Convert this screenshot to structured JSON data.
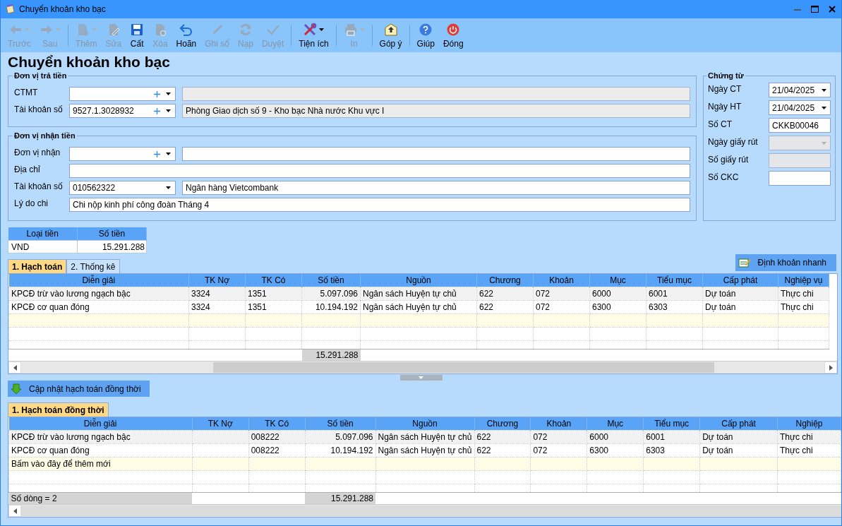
{
  "window": {
    "title": "Chuyển khoản kho bạc"
  },
  "toolbar": {
    "groups": [
      [
        {
          "kind": "back",
          "label": "Trước",
          "disabled": true,
          "dropdown": true
        },
        {
          "kind": "forward",
          "label": "Sau",
          "disabled": true,
          "dropdown": true
        }
      ],
      [
        {
          "kind": "new",
          "label": "Thêm",
          "disabled": true,
          "dropdown": true
        },
        {
          "kind": "edit",
          "label": "Sửa",
          "disabled": true,
          "dropdown": false
        },
        {
          "kind": "save",
          "label": "Cất",
          "disabled": false,
          "dropdown": false
        },
        {
          "kind": "delete",
          "label": "Xóa",
          "disabled": true,
          "dropdown": false
        },
        {
          "kind": "undo",
          "label": "Hoãn",
          "disabled": false,
          "dropdown": false
        },
        {
          "kind": "post",
          "label": "Ghi sổ",
          "disabled": true,
          "dropdown": false
        },
        {
          "kind": "reload",
          "label": "Nạp",
          "disabled": true,
          "dropdown": false
        },
        {
          "kind": "approve",
          "label": "Duyệt",
          "disabled": true,
          "dropdown": false
        }
      ],
      [
        {
          "kind": "tools",
          "label": "Tiện ích",
          "disabled": false,
          "dropdown": true
        }
      ],
      [
        {
          "kind": "print",
          "label": "In",
          "disabled": true,
          "dropdown": true
        }
      ],
      [
        {
          "kind": "feedback",
          "label": "Góp ý",
          "disabled": false,
          "dropdown": false
        }
      ],
      [
        {
          "kind": "help",
          "label": "Giúp",
          "disabled": false,
          "dropdown": false
        },
        {
          "kind": "close",
          "label": "Đóng",
          "disabled": false,
          "dropdown": false
        }
      ]
    ]
  },
  "heading": "Chuyển khoản kho bạc",
  "payer": {
    "legend": "Đơn vị trả tiền",
    "rows": [
      {
        "kind": "combo",
        "label": "CTMT",
        "add": true,
        "description_readonly": true
      },
      {
        "kind": "combo",
        "label": "Tài khoản số",
        "value": "9527.1.3028932",
        "add": true,
        "description": "Phòng Giao dịch số 9 - Kho bạc Nhà nước Khu vực I",
        "description_readonly": true
      }
    ]
  },
  "payee": {
    "legend": "Đơn vị nhận tiền",
    "rows": [
      {
        "kind": "combo",
        "label": "Đơn vị nhận",
        "add": true,
        "description_readonly": false
      },
      {
        "kind": "text",
        "label": "Địa chỉ"
      },
      {
        "kind": "combo",
        "label": "Tài khoản số",
        "value": "010562322",
        "add": false,
        "description": "Ngân hàng Vietcombank",
        "description_readonly": false
      },
      {
        "kind": "text",
        "label": "Lý do chi",
        "value": "Chi nộp kinh phí công đoàn Tháng 4"
      }
    ]
  },
  "voucher": {
    "legend": "Chứng từ",
    "rows": [
      {
        "kind": "date",
        "label": "Ngày CT",
        "value": "21/04/2025",
        "disabled": false
      },
      {
        "kind": "date",
        "label": "Ngày HT",
        "value": "21/04/2025",
        "disabled": false
      },
      {
        "kind": "text",
        "label": "Số CT",
        "value": "CKKB00046",
        "disabled": false
      },
      {
        "kind": "date",
        "label": "Ngày giấy rút",
        "disabled": true
      },
      {
        "kind": "text",
        "label": "Số giấy rút",
        "disabled": true
      },
      {
        "kind": "text",
        "label": "Số CKC",
        "disabled": false
      }
    ]
  },
  "currency_table": {
    "columns": [
      "Loại tiền",
      "Số tiền"
    ],
    "rows": [
      [
        "VND",
        "15.291.288"
      ]
    ]
  },
  "tabs": [
    {
      "label": "1. Hạch toán",
      "selected": true
    },
    {
      "label": "2. Thống kê",
      "selected": false
    }
  ],
  "quick_entry_button": "Định khoản nhanh",
  "entries_grid": {
    "columns": [
      {
        "label": "Diễn giải",
        "kind": "text"
      },
      {
        "label": "TK Nợ",
        "kind": "text"
      },
      {
        "label": "TK Có",
        "kind": "text"
      },
      {
        "label": "Số tiền",
        "kind": "amount"
      },
      {
        "label": "Nguồn",
        "kind": "text"
      },
      {
        "label": "Chương",
        "kind": "text"
      },
      {
        "label": "Khoản",
        "kind": "text"
      },
      {
        "label": "Mục",
        "kind": "text"
      },
      {
        "label": "Tiểu mục",
        "kind": "text"
      },
      {
        "label": "Cấp phát",
        "kind": "text"
      },
      {
        "label": "Nghiệp vụ",
        "kind": "text"
      }
    ],
    "rows": [
      {
        "selected": true,
        "cells": [
          "KPCĐ trừ vào lương ngạch bậc",
          "3324",
          "1351",
          "5.097.096",
          "Ngân sách Huyện tự chủ",
          "622",
          "072",
          "6000",
          "6001",
          "Dự toán",
          "Thực chi"
        ]
      },
      {
        "selected": false,
        "cells": [
          "KPCĐ cơ quan đóng",
          "3324",
          "1351",
          "10.194.192",
          "Ngân sách Huyện tự chủ",
          "622",
          "072",
          "6300",
          "6303",
          "Dự toán",
          "Thực chi"
        ]
      }
    ],
    "footer": {
      "total": "15.291.288"
    }
  },
  "update_button": "Cập nhật hạch toán đồng thời",
  "tabs2": [
    {
      "label": "1. Hạch toán đồng thời",
      "selected": true
    }
  ],
  "simultaneous_grid": {
    "columns": [
      {
        "label": "Diễn giải",
        "kind": "text"
      },
      {
        "label": "TK Nợ",
        "kind": "text"
      },
      {
        "label": "TK Có",
        "kind": "text"
      },
      {
        "label": "Số tiền",
        "kind": "amount"
      },
      {
        "label": "Nguồn",
        "kind": "text"
      },
      {
        "label": "Chương",
        "kind": "text"
      },
      {
        "label": "Khoản",
        "kind": "text"
      },
      {
        "label": "Mục",
        "kind": "text"
      },
      {
        "label": "Tiểu mục",
        "kind": "text"
      },
      {
        "label": "Cấp phát",
        "kind": "text"
      },
      {
        "label": "Nghiệp",
        "kind": "text"
      }
    ],
    "rows": [
      {
        "selected": true,
        "cells": [
          "KPCĐ trừ vào lương ngạch bậc",
          null,
          "008222",
          "5.097.096",
          "Ngân sách Huyện tự chủ",
          "622",
          "072",
          "6000",
          "6001",
          "Dự toán",
          "Thực chi"
        ]
      },
      {
        "selected": false,
        "cells": [
          "KPCĐ cơ quan đóng",
          null,
          "008222",
          "10.194.192",
          "Ngân sách Huyện tự chủ",
          "622",
          "072",
          "6300",
          "6303",
          "Dự toán",
          "Thực chi"
        ]
      }
    ],
    "new_row_hint": "Bấm vào đây để thêm mới",
    "footer": {
      "count": "Số dòng = 2",
      "total": "15.291.288"
    }
  }
}
